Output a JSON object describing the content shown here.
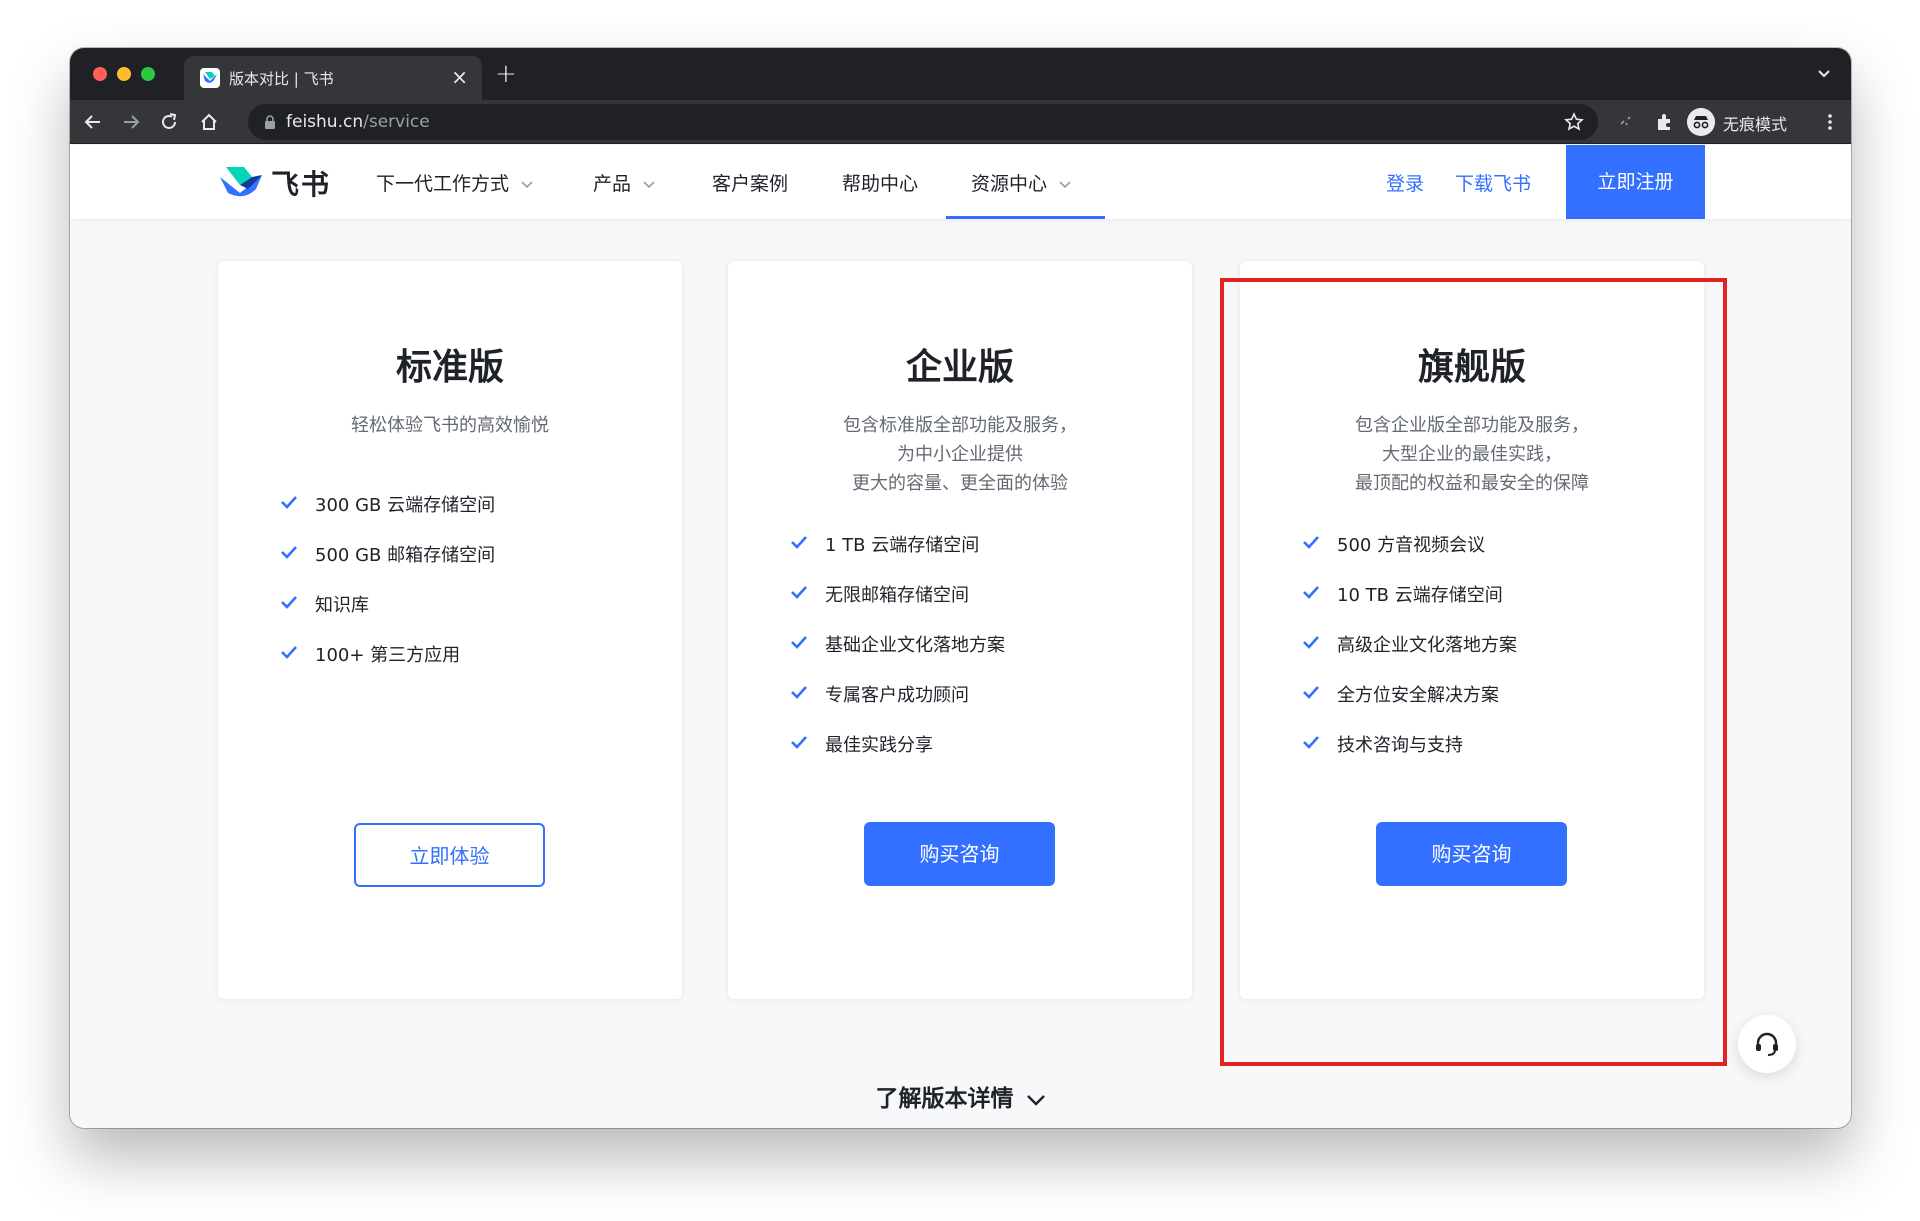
{
  "browser": {
    "tab_title": "版本对比 | 飞书",
    "tab_close": "×",
    "new_tab": "+",
    "url_host": "feishu.cn",
    "url_path": "/service",
    "incognito_label": "无痕模式"
  },
  "header": {
    "logo_text": "飞书",
    "nav": [
      {
        "label": "下一代工作方式",
        "has_dropdown": true
      },
      {
        "label": "产品",
        "has_dropdown": true
      },
      {
        "label": "客户案例",
        "has_dropdown": false
      },
      {
        "label": "帮助中心",
        "has_dropdown": false
      },
      {
        "label": "资源中心",
        "has_dropdown": true,
        "active": true
      }
    ],
    "login": "登录",
    "download": "下载飞书",
    "signup": "立即注册"
  },
  "plans": [
    {
      "title": "标准版",
      "desc": [
        "轻松体验飞书的高效愉悦"
      ],
      "features": [
        "300 GB 云端存储空间",
        "500 GB 邮箱存储空间",
        "知识库",
        "100+ 第三方应用"
      ],
      "button": "立即体验"
    },
    {
      "title": "企业版",
      "desc": [
        "包含标准版全部功能及服务，",
        "为中小企业提供",
        "更大的容量、更全面的体验"
      ],
      "features": [
        "1 TB 云端存储空间",
        "无限邮箱存储空间",
        "基础企业文化落地方案",
        "专属客户成功顾问",
        "最佳实践分享"
      ],
      "button": "购买咨询"
    },
    {
      "title": "旗舰版",
      "desc": [
        "包含企业版全部功能及服务，",
        "大型企业的最佳实践，",
        "最顶配的权益和最安全的保障"
      ],
      "features": [
        "500 方音视频会议",
        "10 TB 云端存储空间",
        "高级企业文化落地方案",
        "全方位安全解决方案",
        "技术咨询与支持"
      ],
      "button": "购买咨询"
    }
  ],
  "more_details": "了解版本详情",
  "colors": {
    "accent": "#3370ff",
    "highlight": "#e0241f"
  },
  "icons": [
    "check-icon",
    "chevron-down-icon",
    "headset-icon",
    "lock-icon",
    "star-icon",
    "incognito-icon",
    "extensions-icon"
  ]
}
